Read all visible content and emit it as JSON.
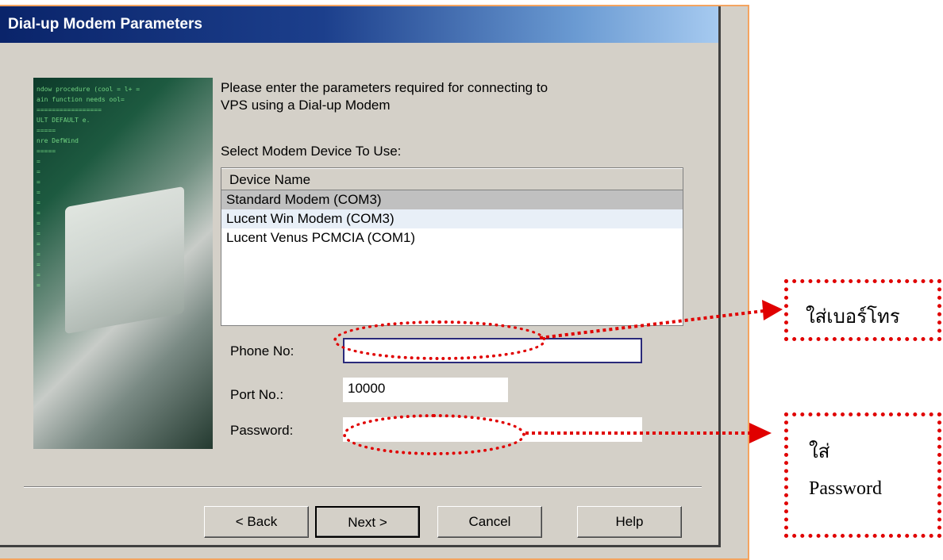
{
  "window": {
    "title": "Dial-up Modem Parameters"
  },
  "intro": {
    "line1": "Please enter the parameters required for connecting to",
    "line2": "VPS using a Dial-up Modem"
  },
  "device_list": {
    "label": "Select Modem Device To Use:",
    "column_header": "Device Name",
    "rows": [
      "Standard Modem (COM3)",
      "Lucent Win Modem (COM3)",
      "Lucent Venus PCMCIA (COM1)"
    ]
  },
  "fields": {
    "phone": {
      "label": "Phone No:",
      "value": ""
    },
    "port": {
      "label": "Port No.:",
      "value": "10000"
    },
    "password": {
      "label": "Password:",
      "value": ""
    }
  },
  "buttons": {
    "back": "< Back",
    "next": "Next >",
    "cancel": "Cancel",
    "help": "Help"
  },
  "annotations": {
    "phone_callout": "ใส่เบอร์โทร",
    "password_callout_line1": "ใส่",
    "password_callout_line2": "Password",
    "color": "#e00000"
  }
}
